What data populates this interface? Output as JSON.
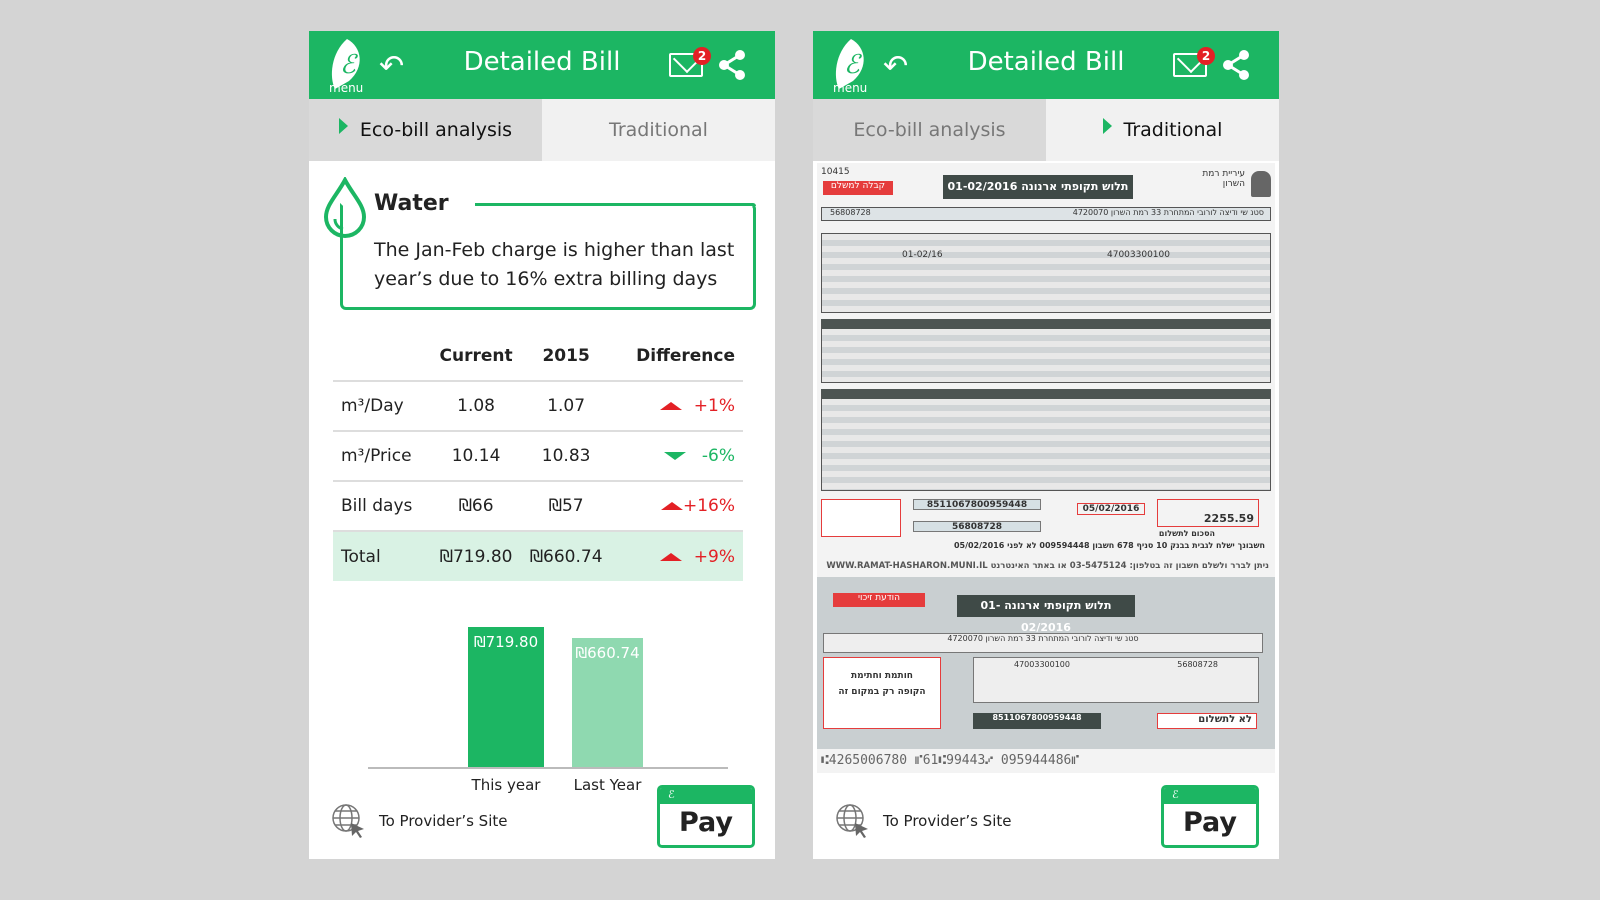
{
  "header": {
    "title": "Detailed Bill",
    "menu_label": "menu",
    "mail_badge": "2",
    "icons": [
      "leaf-logo-icon",
      "back-arrow-icon",
      "mail-icon",
      "share-icon"
    ]
  },
  "tabs": [
    {
      "label": "Eco-bill analysis"
    },
    {
      "label": "Traditional"
    }
  ],
  "water": {
    "title": "Water",
    "message": "The Jan-Feb charge is higher than last year’s due to 16% extra billing days"
  },
  "table": {
    "headers": [
      "",
      "Current",
      "2015",
      "Difference"
    ],
    "rows": [
      {
        "label": "m³/Day",
        "current": "1.08",
        "prev": "1.07",
        "diff": "+1%",
        "trend": "up"
      },
      {
        "label": "m³/Price",
        "current": "10.14",
        "prev": "10.83",
        "diff": "-6%",
        "trend": "down"
      },
      {
        "label": "Bill days",
        "current": "₪66",
        "prev": "₪57",
        "diff": "+16%",
        "trend": "up"
      },
      {
        "label": "Total",
        "current": "₪719.80",
        "prev": "₪660.74",
        "diff": "+9%",
        "trend": "up"
      }
    ]
  },
  "chart_data": {
    "type": "bar",
    "categories": [
      "This year",
      "Last Year"
    ],
    "values": [
      719.8,
      660.74
    ],
    "data_labels": [
      "₪719.80",
      "₪660.74"
    ],
    "colors": [
      "#1cb663",
      "#8fd9b0"
    ]
  },
  "footer": {
    "provider_link": "To Provider’s Site",
    "pay_label": "Pay"
  },
  "bill": {
    "number": "10415",
    "receipt_label": "קבלה למשלם",
    "title": "תלוש תקופתי ארנונה 01-02/2016",
    "issuer": "עיריית רמת השרון",
    "payer_id": "56808728",
    "payer_address": "סטנ שי ודיצה לורובי המתחרת 33 רמת השרון 4720070",
    "asset_no": "47003300100",
    "period": "01-02/16",
    "barcode_no": "8511067800959448",
    "due_date": "05/02/2016",
    "amount": "2255.59",
    "amount_label": "הסכום לתשלום",
    "bank_note": "חשבונך ישלח לגבית בבנק 10 סניף 678 חשבון 009594448 לא לפני 05/02/2016",
    "website_note": "ניתן לברר ולשלם חשבון זה בטלפון: 03-5475124 או באתר האינטרנט WWW.RAMAT-HASHARON.MUNI.IL",
    "notice_label": "הודעת זיכוי",
    "stamp_note": "חותמת וחתימת הקופה רק במקום זה",
    "no_pay": "לא לתשלום",
    "micr": "⑆4265006780 ⑈61⑆99443⑇ 095944486⑈"
  },
  "colors": {
    "brand": "#1cb663",
    "up": "#e32025",
    "down": "#1cb663"
  }
}
